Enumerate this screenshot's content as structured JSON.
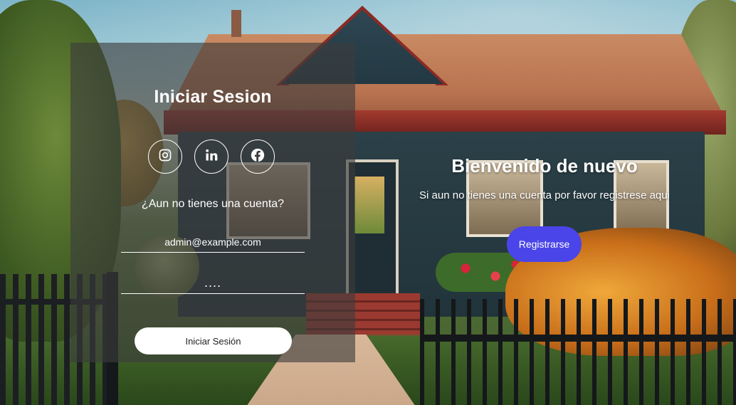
{
  "login": {
    "title": "Iniciar Sesion",
    "socials": [
      {
        "icon": "instagram-icon"
      },
      {
        "icon": "linkedin-icon"
      },
      {
        "icon": "facebook-icon"
      }
    ],
    "no_account_text": "¿Aun no tienes una cuenta?",
    "email_value": "admin@example.com",
    "password_value": "....",
    "submit_label": "Iniciar Sesión"
  },
  "welcome": {
    "title": "Bienvenido de nuevo",
    "text": "Si aun no tienes una cuenta por favor registrese aqui",
    "register_label": "Registrarse"
  },
  "colors": {
    "accent": "#4a45e8",
    "panel_overlay": "rgba(60,60,60,0.62)"
  }
}
